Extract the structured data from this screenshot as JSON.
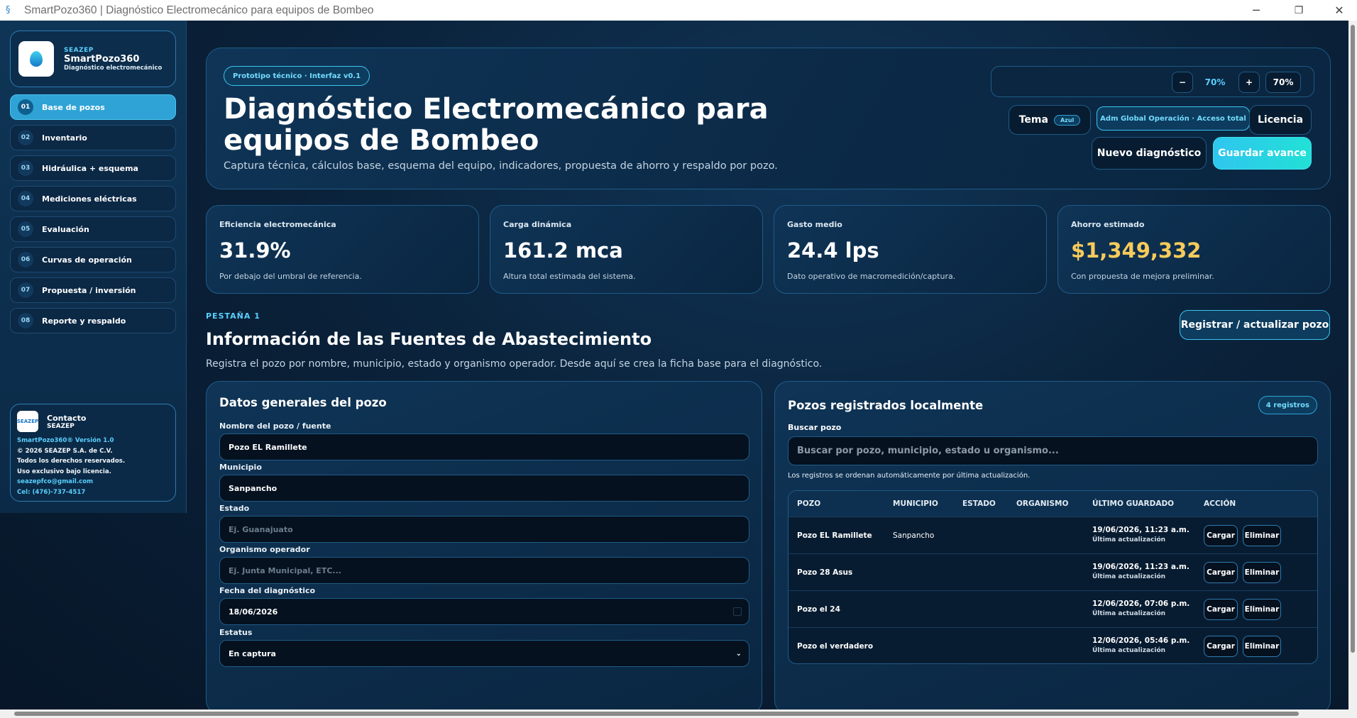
{
  "window": {
    "title": "SmartPozo360 | Diagnóstico Electromecánico para equipos de Bombeo",
    "minimize_icon": "─",
    "maximize_icon": "❐",
    "close_icon": "✕"
  },
  "brand": {
    "kicker": "SEAZEP",
    "name": "SmartPozo360",
    "tagline": "Diagnóstico electromecánico"
  },
  "nav": {
    "items": [
      {
        "num": "01",
        "label": "Base de pozos"
      },
      {
        "num": "02",
        "label": "Inventario"
      },
      {
        "num": "03",
        "label": "Hidráulica + esquema"
      },
      {
        "num": "04",
        "label": "Mediciones eléctricas"
      },
      {
        "num": "05",
        "label": "Evaluación"
      },
      {
        "num": "06",
        "label": "Curvas de operación"
      },
      {
        "num": "07",
        "label": "Propuesta / inversión"
      },
      {
        "num": "08",
        "label": "Reporte y respaldo"
      }
    ]
  },
  "contact": {
    "logo_text": "SEAZEP",
    "title": "Contacto",
    "org": "SEAZEP",
    "version": "SmartPozo360® Versión 1.0",
    "copyright": "© 2026 SEAZEP S.A. de C.V.",
    "rights": "Todos los derechos reservados.",
    "license": "Uso exclusivo bajo licencia.",
    "email": "seazepfco@gmail.com",
    "phone": "Cel: (476)-737-4517"
  },
  "hero": {
    "chip": "Prototipo técnico · Interfaz v0.1",
    "title": "Diagnóstico Electromecánico para equipos de Bombeo",
    "subtitle": "Captura técnica, cálculos base, esquema del equipo, indicadores, propuesta de ahorro y respaldo por pozo.",
    "zoom_minus": "−",
    "zoom_value": "70%",
    "zoom_plus": "+",
    "zoom_reset": "70%",
    "theme_label": "Tema",
    "theme_value": "Azul",
    "admin_label": "Adm Global Operación · Acceso total",
    "license_label": "Licencia",
    "new_label": "Nuevo diagnóstico",
    "save_label": "Guardar avance"
  },
  "kpis": [
    {
      "label": "Eficiencia electromecánica",
      "value": "31.9%",
      "desc": "Por debajo del umbral de referencia."
    },
    {
      "label": "Carga dinámica",
      "value": "161.2 mca",
      "desc": "Altura total estimada del sistema."
    },
    {
      "label": "Gasto medio",
      "value": "24.4 lps",
      "desc": "Dato operativo de macromedición/captura."
    },
    {
      "label": "Ahorro estimado",
      "value": "$1,349,332",
      "desc": "Con propuesta de mejora preliminar."
    }
  ],
  "section": {
    "kicker": "PESTAÑA 1",
    "title": "Información de las Fuentes de Abastecimiento",
    "desc": "Registra el pozo por nombre, municipio, estado y organismo operador. Desde aquí se crea la ficha base para el diagnóstico.",
    "register_label": "Registrar / actualizar pozo"
  },
  "form": {
    "title": "Datos generales del pozo",
    "name_label": "Nombre del pozo / fuente",
    "name_value": "Pozo EL Ramillete",
    "municipio_label": "Municipio",
    "municipio_value": "Sanpancho",
    "estado_label": "Estado",
    "estado_placeholder": "Ej. Guanajuato",
    "organismo_label": "Organismo operador",
    "organismo_placeholder": "Ej. Junta Municipal, ETC...",
    "fecha_label": "Fecha del diagnóstico",
    "fecha_value": "18/06/2026",
    "estatus_label": "Estatus",
    "estatus_value": "En captura"
  },
  "list": {
    "title": "Pozos registrados localmente",
    "count": "4 registros",
    "search_label": "Buscar pozo",
    "search_placeholder": "Buscar por pozo, municipio, estado u organismo...",
    "hint": "Los registros se ordenan automáticamente por última actualización.",
    "columns": [
      "POZO",
      "MUNICIPIO",
      "ESTADO",
      "ORGANISMO",
      "ÚLTIMO GUARDADO",
      "ACCIÓN"
    ],
    "load_label": "Cargar",
    "delete_label": "Eliminar",
    "rows": [
      {
        "pozo": "Pozo EL Ramillete",
        "municipio": "Sanpancho",
        "estado": "",
        "organismo": "",
        "fecha": "19/06/2026, 11:23 a.m.",
        "nota": "Última actualización"
      },
      {
        "pozo": "Pozo 28 Asus",
        "municipio": "",
        "estado": "",
        "organismo": "",
        "fecha": "19/06/2026, 11:23 a.m.",
        "nota": "Última actualización"
      },
      {
        "pozo": "Pozo el 24",
        "municipio": "",
        "estado": "",
        "organismo": "",
        "fecha": "12/06/2026, 07:06 p.m.",
        "nota": "Última actualización"
      },
      {
        "pozo": "Pozo el verdadero",
        "municipio": "",
        "estado": "",
        "organismo": "",
        "fecha": "12/06/2026, 05:46 p.m.",
        "nota": "Última actualización"
      }
    ]
  }
}
